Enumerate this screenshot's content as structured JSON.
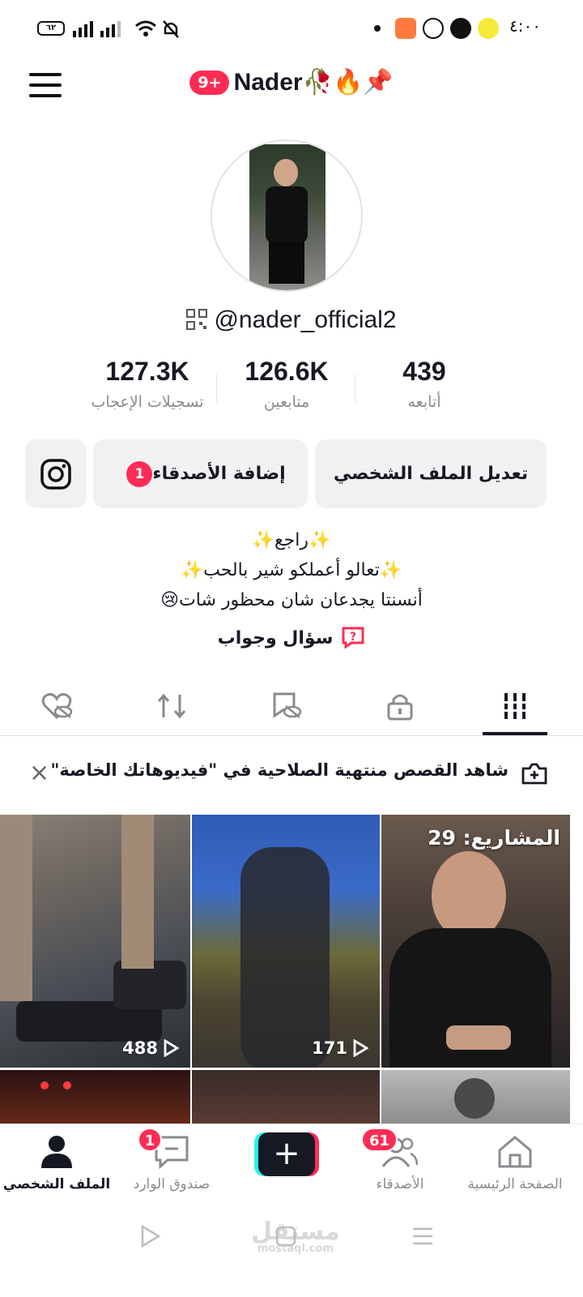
{
  "status_bar": {
    "time": "٤:٠٠",
    "battery": "٦٢"
  },
  "header": {
    "notif_badge": "9+",
    "username_display": "Nader🥀🔥📌"
  },
  "profile": {
    "handle": "@nader_official2"
  },
  "stats": [
    {
      "value": "439",
      "label": "أتابعه"
    },
    {
      "value": "126.6K",
      "label": "متابعين"
    },
    {
      "value": "127.3K",
      "label": "تسجيلات الإعجاب"
    }
  ],
  "actions": {
    "edit_profile": "تعديل الملف الشخصي",
    "add_friends": "إضافة الأصدقاء",
    "add_friends_badge": "1"
  },
  "bio": {
    "line1": "✨راجع✨",
    "line2": "✨تعالو أعملكو شير بالحب✨",
    "line3": "أنسنتا يجدعان شان محظور شات😢",
    "qa_label": "سؤال وجواب"
  },
  "banner": {
    "text": "شاهد القصص منتهية الصلاحية في \"فيديوهاتك الخاصة\"",
    "close": "×"
  },
  "videos": [
    {
      "views": "488"
    },
    {
      "views": "171"
    },
    {
      "projects_label": "المشاريع: 29"
    }
  ],
  "bottom_nav": {
    "home": "الصفحة الرئيسية",
    "friends": "الأصدقاء",
    "friends_badge": "61",
    "inbox": "صندوق الوارد",
    "inbox_badge": "1",
    "profile": "الملف الشخصي",
    "create": "+"
  },
  "watermark": {
    "text": "مستقل",
    "sub": "mostaql.com"
  }
}
